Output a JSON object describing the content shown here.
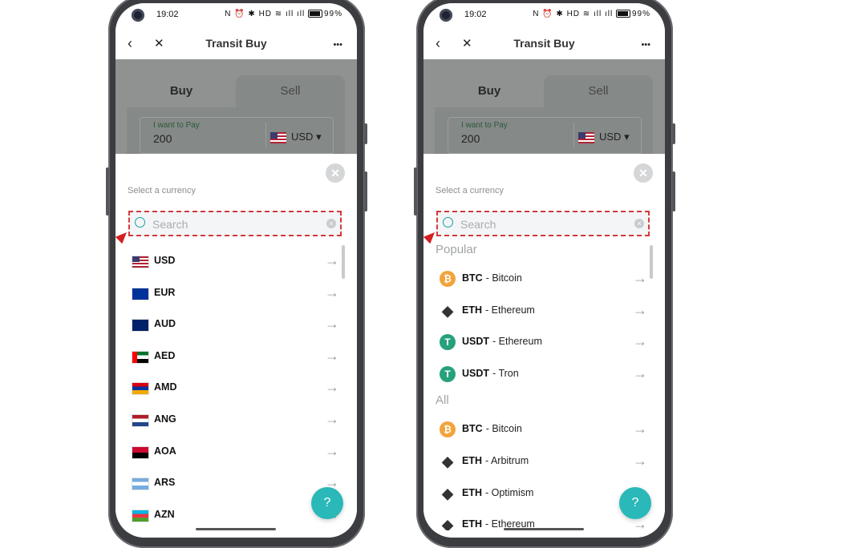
{
  "status": {
    "time": "19:02",
    "battery": "99%",
    "icons": "N ⏰ ✱ HD ≋ ıll ıll"
  },
  "header": {
    "back": "‹",
    "close": "✕",
    "title": "Transit Buy",
    "more": "•••"
  },
  "background_form": {
    "tab_buy": "Buy",
    "tab_sell": "Sell",
    "pay_label": "I want to Pay",
    "pay_value": "200",
    "pay_currency": "USD"
  },
  "sheet": {
    "label": "Select a currency",
    "search_placeholder": "Search"
  },
  "left_list": [
    {
      "code": "USD"
    },
    {
      "code": "EUR"
    },
    {
      "code": "AUD"
    },
    {
      "code": "AED"
    },
    {
      "code": "AMD"
    },
    {
      "code": "ANG"
    },
    {
      "code": "AOA"
    },
    {
      "code": "ARS"
    },
    {
      "code": "AZN"
    }
  ],
  "right_list": {
    "popular_label": "Popular",
    "popular": [
      {
        "code": "BTC",
        "name": "- Bitcoin",
        "icon": "btc"
      },
      {
        "code": "ETH",
        "name": "- Ethereum",
        "icon": "eth"
      },
      {
        "code": "USDT",
        "name": "- Ethereum",
        "icon": "usdt"
      },
      {
        "code": "USDT",
        "name": "- Tron",
        "icon": "usdt"
      }
    ],
    "all_label": "All",
    "all": [
      {
        "code": "BTC",
        "name": "- Bitcoin",
        "icon": "btc"
      },
      {
        "code": "ETH",
        "name": "- Arbitrum",
        "icon": "eth"
      },
      {
        "code": "ETH",
        "name": "- Optimism",
        "icon": "eth"
      },
      {
        "code": "ETH",
        "name": "- Ethereum",
        "icon": "eth"
      }
    ]
  },
  "help_icon": "?",
  "colors": {
    "accent": "#2ab8b8",
    "highlight": "#d23a3a",
    "btc": "#f2a33a",
    "usdt": "#26a17b"
  }
}
